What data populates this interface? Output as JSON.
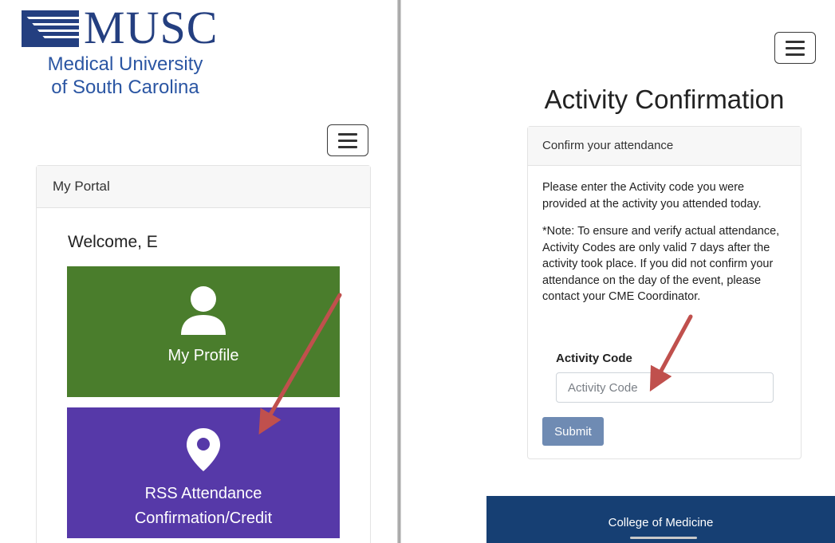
{
  "left": {
    "logo": {
      "wordmark": "MUSC",
      "subtitle_line1": "Medical University",
      "subtitle_line2": "of South Carolina"
    },
    "menu_icon": "hamburger-menu-icon",
    "portal": {
      "header": "My Portal",
      "welcome": "Welcome, E",
      "tiles": [
        {
          "label": "My Profile",
          "icon": "user-icon",
          "color": "#4a7d2c"
        },
        {
          "label_line1": "RSS Attendance",
          "label_line2": "Confirmation/Credit",
          "icon": "map-pin-icon",
          "color": "#5639a8"
        }
      ]
    }
  },
  "right": {
    "menu_icon": "hamburger-menu-icon",
    "title": "Activity Confirmation",
    "card": {
      "header": "Confirm your attendance",
      "instructions": "Please enter the Activity code you were provided at the activity you attended today.",
      "note": "*Note: To ensure and verify actual attendance, Activity Codes are only valid 7 days after the activity took place. If you did not confirm your attendance on the day of the event, please contact your CME Coordinator.",
      "field_label": "Activity Code",
      "field_placeholder": "Activity Code",
      "field_value": "",
      "submit_label": "Submit"
    },
    "footer": "College of Medicine"
  },
  "colors": {
    "brand_navy": "#243f80",
    "brand_blue": "#2b56a3",
    "profile_green": "#4a7d2c",
    "rss_purple": "#5639a8",
    "submit_blue": "#6f8bb3",
    "footer_navy": "#163f73",
    "annotation_arrow": "#c0504d"
  }
}
